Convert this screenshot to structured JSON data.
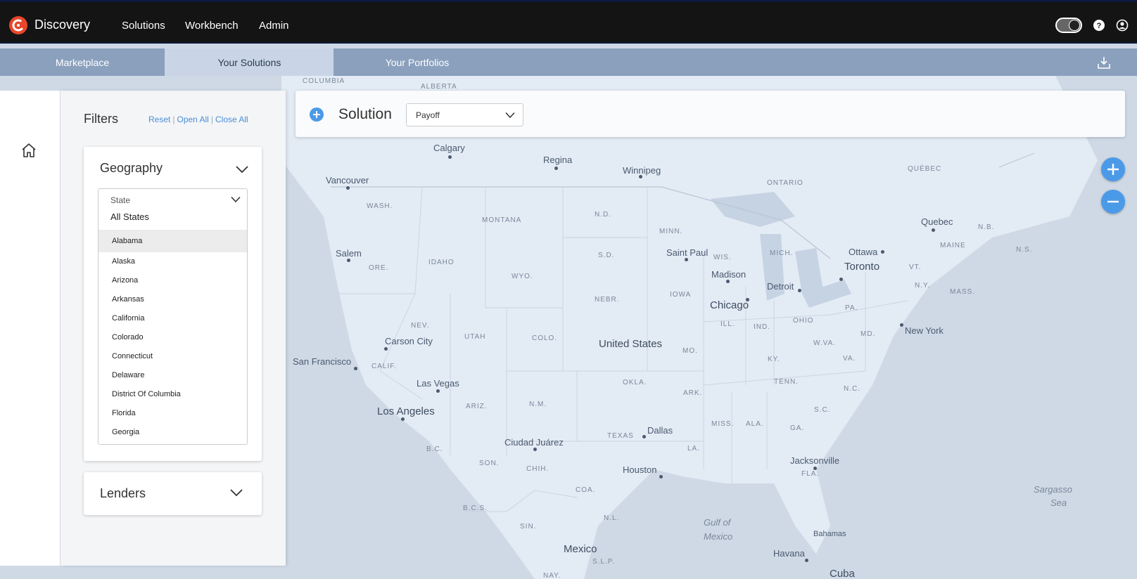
{
  "app": {
    "title": "Discovery"
  },
  "nav": {
    "solutions": "Solutions",
    "workbench": "Workbench",
    "admin": "Admin"
  },
  "tabs": [
    {
      "label": "Marketplace"
    },
    {
      "label": "Your Solutions",
      "active": true
    },
    {
      "label": "Your Portfolios"
    }
  ],
  "filters": {
    "title": "Filters",
    "reset": "Reset",
    "open_all": "Open All",
    "close_all": "Close All",
    "separator": "|"
  },
  "geography": {
    "title": "Geography",
    "state_label": "State",
    "state_value": "All States",
    "states": [
      "Alabama",
      "Alaska",
      "Arizona",
      "Arkansas",
      "California",
      "Colorado",
      "Connecticut",
      "Delaware",
      "District Of Columbia",
      "Florida",
      "Georgia"
    ],
    "highlighted": "Alabama"
  },
  "lenders": {
    "title": "Lenders"
  },
  "solution": {
    "title": "Solution",
    "selected": "Payoff"
  },
  "map_labels": {
    "columbia": "COLUMBIA",
    "alberta": "ALBERTA",
    "calgary": "Calgary",
    "regina": "Regina",
    "winnipeg": "Winnipeg",
    "ontario": "ONTARIO",
    "quebec_prov": "QUÉBEC",
    "vancouver": "Vancouver",
    "wash": "WASH.",
    "montana": "MONTANA",
    "nd": "N.D.",
    "minn": "MINN.",
    "quebec": "Quebec",
    "nb": "N.B.",
    "maine": "MAINE",
    "ns": "N.S.",
    "salem": "Salem",
    "ore": "ORE.",
    "idaho": "IDAHO",
    "sd": "S.D.",
    "saint_paul": "Saint Paul",
    "wis": "WIS.",
    "mich": "MICH.",
    "ottawa": "Ottawa",
    "toronto": "Toronto",
    "vt": "VT.",
    "wyo": "WYO.",
    "madison": "Madison",
    "detroit": "Detroit",
    "ny": "N.Y.",
    "mass": "MASS.",
    "nebr": "NEBR.",
    "iowa": "IOWA",
    "chicago": "Chicago",
    "pa": "PA.",
    "new_york": "New York",
    "carson_city": "Carson City",
    "nev": "NEV.",
    "utah": "UTAH",
    "colo": "COLO.",
    "united_states": "United States",
    "ill": "ILL.",
    "ind": "IND.",
    "ohio": "OHIO",
    "md": "MD.",
    "san_francisco": "San Francisco",
    "calif": "CALIF.",
    "las_vegas": "Las Vegas",
    "mo": "MO.",
    "ky": "KY.",
    "wva": "W.VA.",
    "va": "VA.",
    "okla": "OKLA.",
    "tenn": "TENN.",
    "nc": "N.C.",
    "los_angeles": "Los Angeles",
    "ariz": "ARIZ.",
    "nm": "N.M.",
    "ark": "ARK.",
    "sc": "S.C.",
    "dallas": "Dallas",
    "miss": "MISS.",
    "ala": "ALA.",
    "ga": "GA.",
    "ciudad_juarez": "Ciudad Juárez",
    "texas": "TEXAS",
    "la": "LA.",
    "jacksonville": "Jacksonville",
    "bc": "B.C.",
    "son": "SON.",
    "chih": "CHIH.",
    "houston": "Houston",
    "fla": "FLA.",
    "sargasso": "Sargasso",
    "sea": "Sea",
    "coa": "COA.",
    "gulf_of": "Gulf of",
    "mexico_gulf": "Mexico",
    "bcs": "B.C.S.",
    "sin": "SIN.",
    "nl": "N.L.",
    "bahamas": "Bahamas",
    "mexico": "Mexico",
    "slp": "S.L.P.",
    "havana": "Havana",
    "nay": "NAY.",
    "cuba": "Cuba"
  }
}
